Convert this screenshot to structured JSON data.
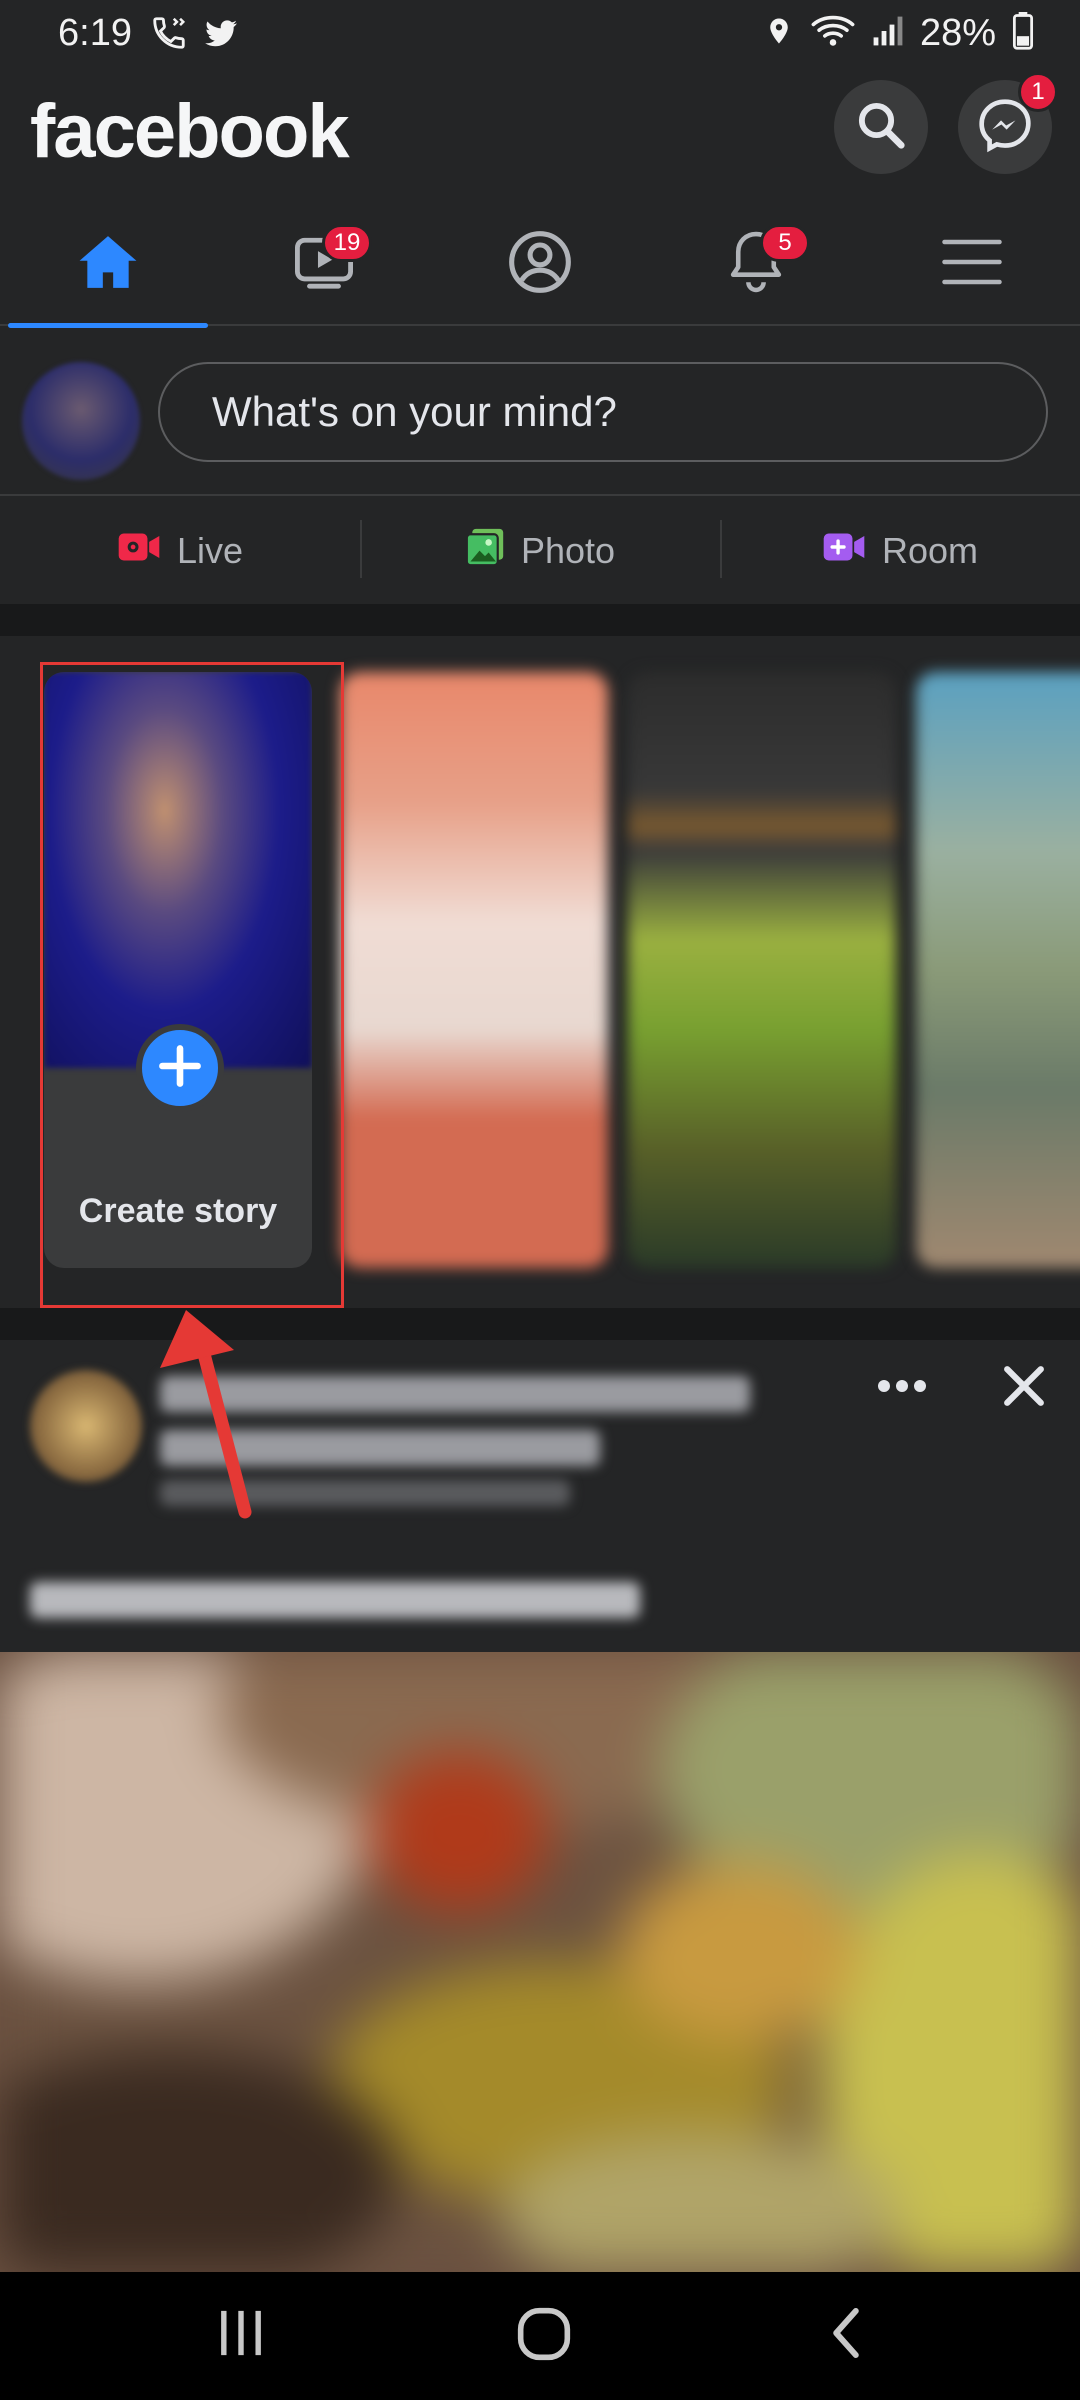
{
  "status_bar": {
    "time": "6:19",
    "battery": "28%"
  },
  "header": {
    "logo": "facebook",
    "messenger_badge": "1"
  },
  "tabs": [
    {
      "name": "home",
      "badge": ""
    },
    {
      "name": "watch",
      "badge": "19"
    },
    {
      "name": "profile",
      "badge": ""
    },
    {
      "name": "notifications",
      "badge": "5"
    },
    {
      "name": "menu",
      "badge": ""
    }
  ],
  "composer": {
    "placeholder": "What's on your mind?"
  },
  "actions": {
    "live": "Live",
    "photo": "Photo",
    "room": "Room"
  },
  "stories": {
    "create_label": "Create story"
  },
  "icons": [
    "wifi-calling-icon",
    "twitter-icon",
    "location-icon",
    "wifi-icon",
    "signal-icon",
    "battery-icon",
    "search-icon",
    "messenger-icon",
    "home-icon",
    "watch-icon",
    "profile-icon",
    "bell-icon",
    "menu-icon",
    "plus-icon",
    "more-icon",
    "close-icon"
  ],
  "colors": {
    "accent": "#2d88ff",
    "badge": "#e41e3f",
    "highlight": "#e53935",
    "background": "#242526"
  }
}
